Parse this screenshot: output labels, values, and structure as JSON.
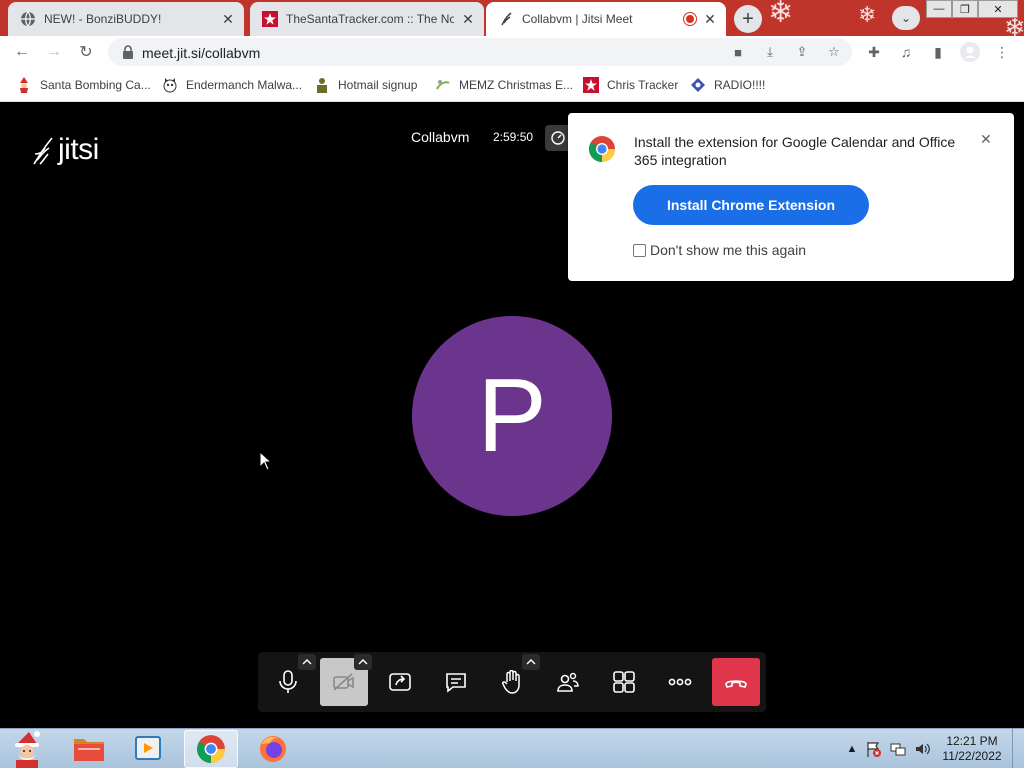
{
  "browser": {
    "tabs": [
      {
        "title": "NEW! - BonziBUDDY!",
        "icon": "globe-icon",
        "active": false
      },
      {
        "title": "TheSantaTracker.com :: The North",
        "icon": "santa-tracker-icon",
        "active": false
      },
      {
        "title": "Collabvm | Jitsi Meet",
        "icon": "jitsi-icon",
        "active": true,
        "recording": true
      }
    ],
    "url": "meet.jit.si/collabvm",
    "bookmarks": [
      {
        "label": "Santa Bombing Ca...",
        "icon": "santa-icon"
      },
      {
        "label": "Endermanch Malwa...",
        "icon": "cat-icon"
      },
      {
        "label": "Hotmail signup",
        "icon": "person-icon"
      },
      {
        "label": "MEMZ Christmas E...",
        "icon": "memz-icon"
      },
      {
        "label": "Chris Tracker",
        "icon": "tracker-icon"
      },
      {
        "label": "RADIO!!!!",
        "icon": "radio-icon"
      }
    ],
    "theme_color": "#c0352b"
  },
  "meeting": {
    "logo_text": "jitsi",
    "room_name": "Collabvm",
    "elapsed": "2:59:50",
    "avatar_letter": "P",
    "avatar_color": "#6b358e",
    "toolbar": {
      "buttons": [
        "microphone",
        "camera-off",
        "share-screen",
        "chat",
        "raise-hand",
        "participants",
        "tile-view",
        "more-actions",
        "leave-meeting"
      ]
    }
  },
  "notification": {
    "message": "Install the extension for Google Calendar and Office 365 integration",
    "install_label": "Install Chrome Extension",
    "dont_show_label": "Don't show me this again",
    "dont_show_checked": false
  },
  "taskbar": {
    "time": "12:21 PM",
    "date": "11/22/2022"
  }
}
